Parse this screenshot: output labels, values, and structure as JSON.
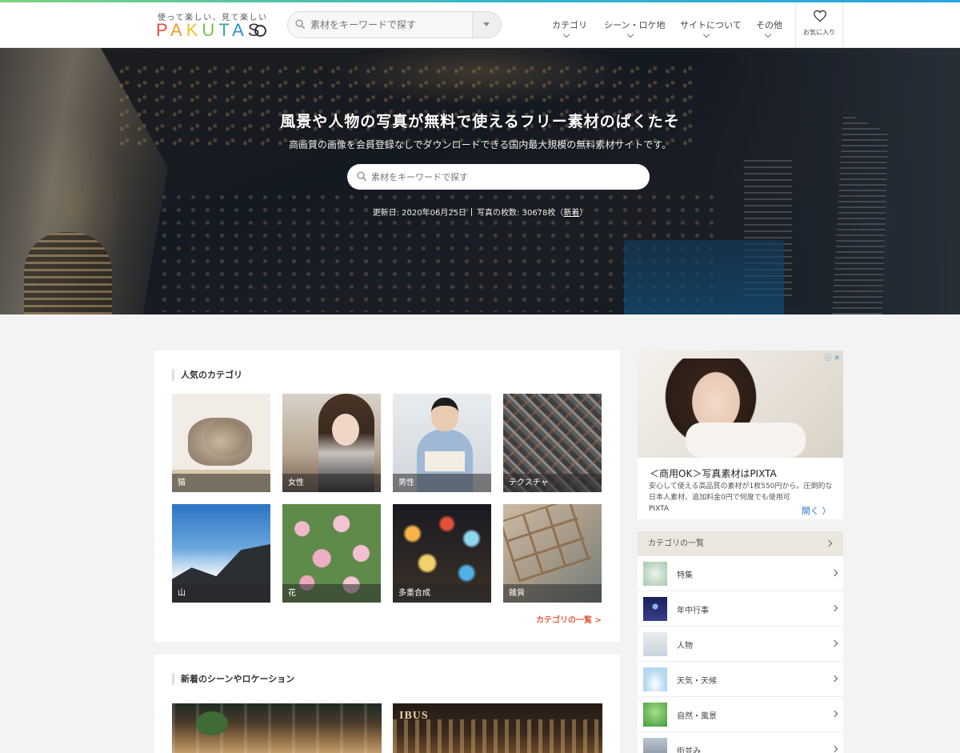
{
  "header": {
    "logo_tagline": "使って楽しい、見て楽しい",
    "logo_text": [
      "P",
      "A",
      "K",
      "U",
      "T",
      "A",
      "S"
    ],
    "search_placeholder": "素材をキーワードで探す",
    "nav": [
      {
        "label": "カテゴリ"
      },
      {
        "label": "シーン・ロケ地"
      },
      {
        "label": "サイトについて"
      },
      {
        "label": "その他"
      }
    ],
    "favorites_label": "お気に入り"
  },
  "hero": {
    "title": "風景や人物の写真が無料で使えるフリー素材のぱくたそ",
    "subtitle": "高画質の画像を会員登録なしでダウンロードできる国内最大規模の無料素材サイトです。",
    "search_placeholder": "素材をキーワードで探す",
    "updated": "更新日: 2020年06月25日",
    "photo_count": "写真の枚数: 30678枚（",
    "new_link": "新着",
    "close_paren": "）"
  },
  "popular": {
    "title": "人気のカテゴリ",
    "items": [
      {
        "label": "猫"
      },
      {
        "label": "女性"
      },
      {
        "label": "男性"
      },
      {
        "label": "テクスチャ"
      },
      {
        "label": "山"
      },
      {
        "label": "花"
      },
      {
        "label": "多重合成"
      },
      {
        "label": "雑貨"
      }
    ],
    "more_link": "カテゴリの一覧 >"
  },
  "scenes": {
    "title": "新着のシーンやロケーション",
    "bar_sign": "IBUS"
  },
  "ad": {
    "title": "＜商用OK＞写真素材はPIXTA",
    "description": "安心して使える高品質の素材が1枚550円から。圧倒的な日本人素材、追加料金0円で何度でも使用可",
    "source": "PIXTA",
    "open_label": "開く",
    "icons": "ⓘ ✕"
  },
  "category_list": {
    "title": "カテゴリの一覧",
    "items": [
      {
        "label": "特集"
      },
      {
        "label": "年中行事"
      },
      {
        "label": "人物"
      },
      {
        "label": "天気・天候"
      },
      {
        "label": "自然・風景"
      },
      {
        "label": "街並み"
      }
    ]
  },
  "colors": {
    "accent_link": "#e85c3c",
    "ad_link": "#2f7ac8"
  }
}
